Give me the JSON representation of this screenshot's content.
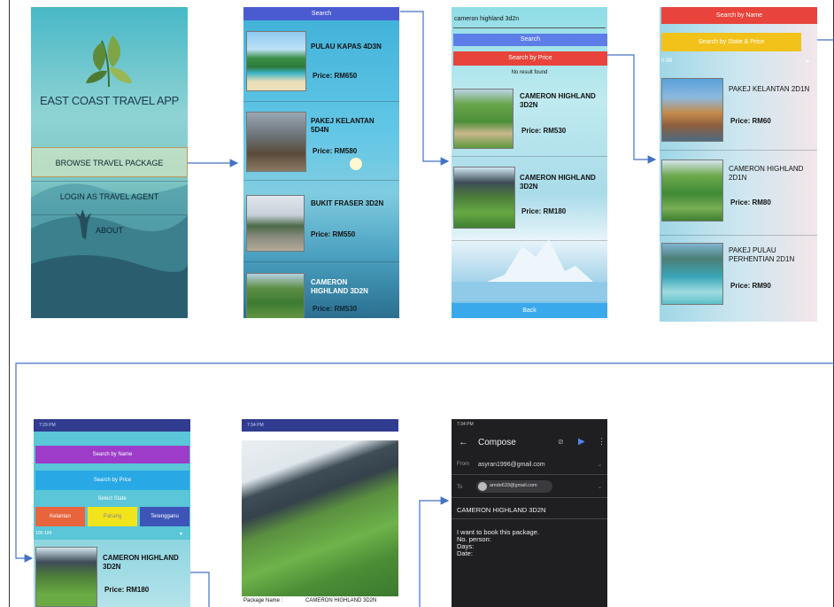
{
  "screen1": {
    "title": "EAST COAST TRAVEL APP",
    "buttons": [
      "BROWSE TRAVEL PACKAGE",
      "LOGIN AS TRAVEL AGENT",
      "ABOUT"
    ]
  },
  "screen2": {
    "search_label": "Search",
    "packages": [
      {
        "name": "PULAU KAPAS 4D3N",
        "price": "Price: RM650"
      },
      {
        "name": "PAKEJ KELANTAN 5D4N",
        "price": "Price: RM580"
      },
      {
        "name": "BUKIT FRASER 3D2N",
        "price": "Price: RM550"
      },
      {
        "name": "CAMERON HIGHLAND 3D2N",
        "price": "Price: RM530"
      }
    ]
  },
  "screen3": {
    "search_value": "cameron highland 3d2n",
    "search_label": "Search",
    "search_price_label": "Search by Price",
    "no_result": "No result found",
    "packages": [
      {
        "name": "CAMERON HIGHLAND 3D2N",
        "price": "Price: RM530"
      },
      {
        "name": "CAMERON HIGHLAND 3D2N",
        "price": "Price: RM180"
      }
    ],
    "back_label": "Back"
  },
  "screen4": {
    "search_name_label": "Search by Name",
    "search_state_price_label": "Search by State & Price",
    "range_label": "0-99",
    "packages": [
      {
        "name": "PAKEJ KELANTAN 2D1N",
        "price": "Price: RM60"
      },
      {
        "name": "CAMERON HIGHLAND 2D1N",
        "price": "Price: RM80"
      },
      {
        "name": "PAKEJ PULAU PERHENTIAN 2D1N",
        "price": "Price: RM90"
      }
    ]
  },
  "screen5": {
    "status_time": "7:29 PM",
    "search_name_label": "Search by Name",
    "search_price_label": "Search by Price",
    "select_state_label": "Select State",
    "states": [
      "Kelantan",
      "Pahang",
      "Terengganu"
    ],
    "range_label": "100-199",
    "package": {
      "name": "CAMERON HIGHLAND 3D2N",
      "price": "Price: RM180"
    }
  },
  "screen6": {
    "status_time": "7:34 PM",
    "package_name_label": "Package Name :",
    "package_name_value": "CAMERON HIGHLAND 3D2N"
  },
  "screen7": {
    "status_time": "7:34 PM",
    "title": "Compose",
    "from_label": "From",
    "from_value": "asyran1996@gmail.com",
    "to_label": "To",
    "to_value": "amde633@gmail.com",
    "subject": "CAMERON HIGHLAND 3D2N",
    "body_lines": [
      "I want to book this package.",
      "No. person:",
      "Days:",
      "Date:"
    ]
  },
  "colors": {
    "accent_blue": "#4a5bd1",
    "red": "#e8443c",
    "yellow": "#f2c21b",
    "purple": "#9c3cc8",
    "arrow": "#4472c4"
  }
}
